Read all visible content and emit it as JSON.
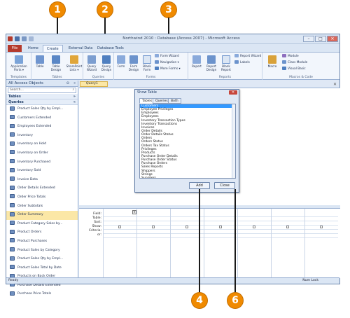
{
  "window": {
    "title": "Northwind 2010 : Database (Access 2007) - Microsoft Access",
    "minimize": "–",
    "maximize": "□",
    "close": "✕"
  },
  "ribbon": {
    "tabs": [
      "File",
      "Home",
      "Create",
      "External Data",
      "Database Tools"
    ],
    "active_tab": "Create",
    "groups": {
      "templates": {
        "label": "Templates",
        "buttons": [
          "Application Parts ▾"
        ]
      },
      "tables": {
        "label": "Tables",
        "buttons": [
          "Table",
          "Table Design",
          "SharePoint Lists ▾"
        ]
      },
      "queries": {
        "label": "Queries",
        "buttons": [
          "Query Wizard",
          "Query Design"
        ]
      },
      "forms": {
        "label": "Forms",
        "buttons": [
          "Form",
          "Form Design",
          "Blank Form"
        ],
        "small": [
          "Form Wizard",
          "Navigation ▾",
          "More Forms ▾"
        ]
      },
      "reports": {
        "label": "Reports",
        "buttons": [
          "Report",
          "Report Design",
          "Blank Report"
        ],
        "small": [
          "Report Wizard",
          "Labels"
        ]
      },
      "macros": {
        "label": "Macros & Code",
        "buttons": [
          "Macro"
        ],
        "small": [
          "Module",
          "Class Module",
          "Visual Basic"
        ]
      }
    }
  },
  "nav": {
    "header": "All Access Objects",
    "search_placeholder": "Search...",
    "categories": [
      "Tables",
      "Queries"
    ],
    "items": [
      "Product Sales Qty by Empl...",
      "Customers Extended",
      "Employees Extended",
      "Inventory",
      "Inventory on Hold",
      "Inventory on Order",
      "Inventory Purchased",
      "Inventory Sold",
      "Invoice Data",
      "Order Details Extended",
      "Order Price Totals",
      "Order Subtotals",
      "Order Summary",
      "Product Category Sales by...",
      "Product Orders",
      "Product Purchases",
      "Product Sales by Category",
      "Product Sales Qty by Empl...",
      "Product Sales Total by Date",
      "Products on Back Order",
      "Purchase Details Extended",
      "Purchase Price Totals"
    ]
  },
  "document": {
    "tab_label": "Query1",
    "grid_rows": [
      "Field:",
      "Table:",
      "Sort:",
      "Show:",
      "Criteria:",
      "or:"
    ]
  },
  "dialog": {
    "title": "Show Table",
    "tabs": [
      "Tables",
      "Queries",
      "Both"
    ],
    "items": [
      "Customers",
      "Employee Privileges",
      "Employees",
      "Employees",
      "Inventory Transaction Types",
      "Inventory Transactions",
      "Invoices",
      "Order Details",
      "Order Details Status",
      "Orders",
      "Orders Status",
      "Orders Tax Status",
      "Privileges",
      "Products",
      "Purchase Order Details",
      "Purchase Order Status",
      "Purchase Orders",
      "Sales Reports",
      "Shippers",
      "Strings",
      "Suppliers"
    ],
    "add_label": "Add",
    "close_label": "Close"
  },
  "status": {
    "left": "Ready",
    "right": "Num Lock"
  },
  "callouts": [
    "1",
    "2",
    "3",
    "4",
    "6"
  ],
  "colors": {
    "callout": "#f08a00",
    "file_tab": "#b53a2c",
    "selection": "#3399ff",
    "highlight": "#fbe7a6"
  }
}
